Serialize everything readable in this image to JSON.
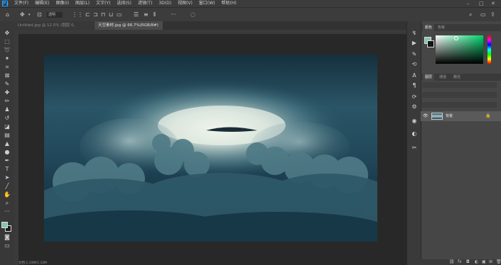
{
  "app": {
    "logo_label": "Ps"
  },
  "menubar": {
    "items": [
      "文件(F)",
      "编辑(E)",
      "图像(I)",
      "图层(L)",
      "文字(Y)",
      "选择(S)",
      "滤镜(T)",
      "3D(D)",
      "视图(V)",
      "窗口(W)",
      "帮助(H)"
    ],
    "minimize": "–",
    "maximize": "□",
    "close": "✕"
  },
  "tabs": [
    {
      "label": "Untitled.jpg @ 12.5% (图层 0, RGB/8#)",
      "active": false,
      "close": "×"
    },
    {
      "label": "天空素材.jpg @ 66.7%(RGB/8#)",
      "active": true,
      "close": "×"
    }
  ],
  "options": {
    "home": "⌂",
    "mode_label": "透明"
  },
  "status": {
    "text": "文档:1.33M/1.33M"
  },
  "color_panel": {
    "tabs": [
      "颜色",
      "色板"
    ],
    "fg_color": "#7fc7b2",
    "bg_color": "#151515"
  },
  "layers_panel": {
    "tabs": [
      "图层",
      "通道",
      "路径"
    ],
    "layers": [
      {
        "name": "背景",
        "visible": true,
        "locked": true
      }
    ]
  },
  "canvas": {
    "image_description_name": "cloud-photo"
  }
}
